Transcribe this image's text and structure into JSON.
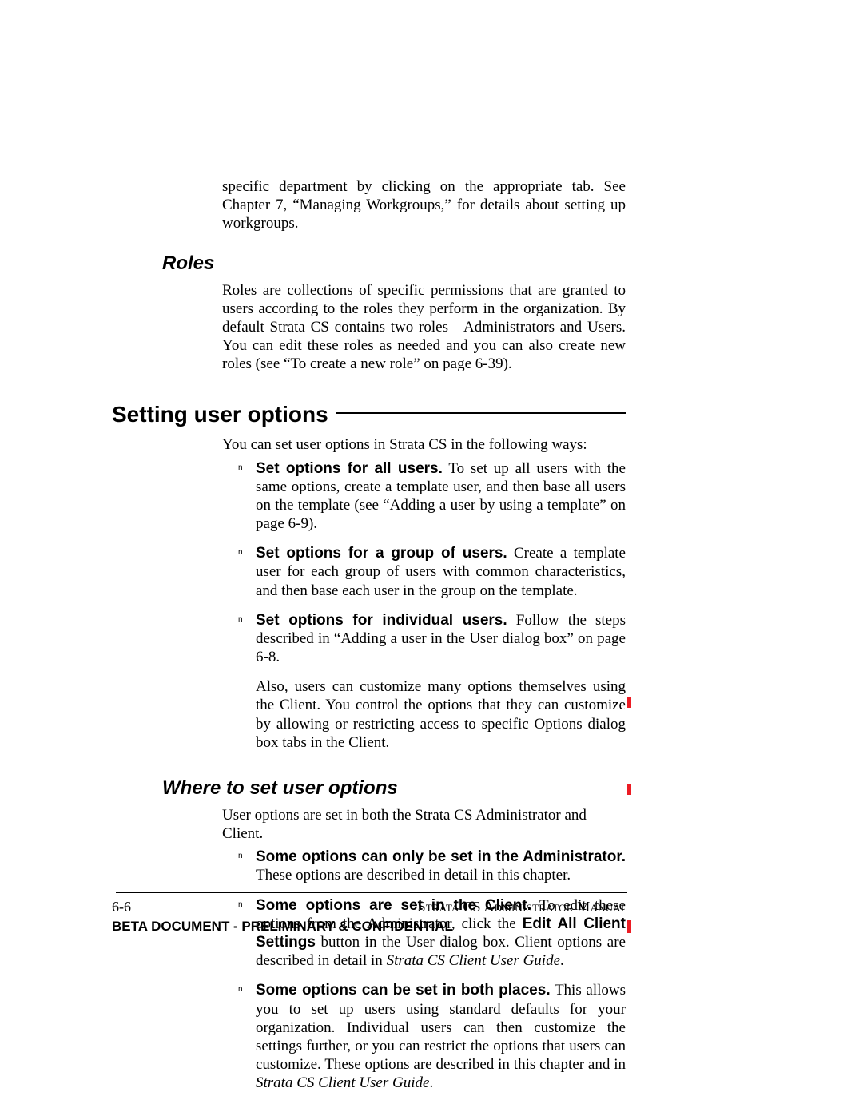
{
  "intro_top": "specific department by clicking on the appropriate tab. See Chapter 7, “Managing Workgroups,”  for details about setting up workgroups.",
  "roles": {
    "heading": "Roles",
    "body": "Roles are collections of specific permissions that are granted to users according to the roles they perform in the organization. By default Strata CS contains two roles—Administrators and Users. You can edit these roles as needed and you can also create new roles (see “To create a new role” on page 6-39)."
  },
  "setting": {
    "heading": "Setting user options",
    "intro": "You can set user options in Strata CS in the following ways:",
    "items": [
      {
        "bold": "Set options for all users.",
        "rest": " To set up all users with the same options, create a template user, and then base all users on the template (see “Adding a user by using a template” on page 6-9)."
      },
      {
        "bold": "Set options for a group of users.",
        "rest": " Create a template user for each group of users with common characteristics, and then base each user in the group on the template."
      },
      {
        "bold": "Set options for individual users.",
        "rest": "  Follow the steps described in “Adding a user in the User dialog box” on page 6-8."
      }
    ],
    "after": "Also, users can customize many options themselves using the Client. You control the options that they can customize by allowing or restricting access to specific Options dialog box tabs in the Client."
  },
  "where": {
    "heading": "Where to set user options",
    "intro": "User options are set in both the Strata CS Administrator and Client.",
    "items": [
      {
        "bold": "Some options can only be set in the Administrator.",
        "rest": " These options are described in detail in this chapter."
      },
      {
        "bold": "Some options are set in the Client.",
        "mid1": "  To edit these options from the Administrator, click the ",
        "bold2": "Edit All Client Settings",
        "mid2": " button in the User dialog box. Client options are described in detail in ",
        "ital": "Strata CS Client User Guide",
        "tail": "."
      },
      {
        "bold": "Some options can be set in both places.",
        "mid": " This allows you to set up users using standard defaults for your organization. Individual users can then customize the settings further, or you can restrict the options that users can customize. These options are described in this chapter and in ",
        "ital": "Strata CS Client User Guide",
        "tail": "."
      }
    ]
  },
  "footer": {
    "page": "6-6",
    "manual": "Strata CS Administrator Manual",
    "confidential": "BETA DOCUMENT - PRELIMINARY & CONFIDENTIAL"
  }
}
